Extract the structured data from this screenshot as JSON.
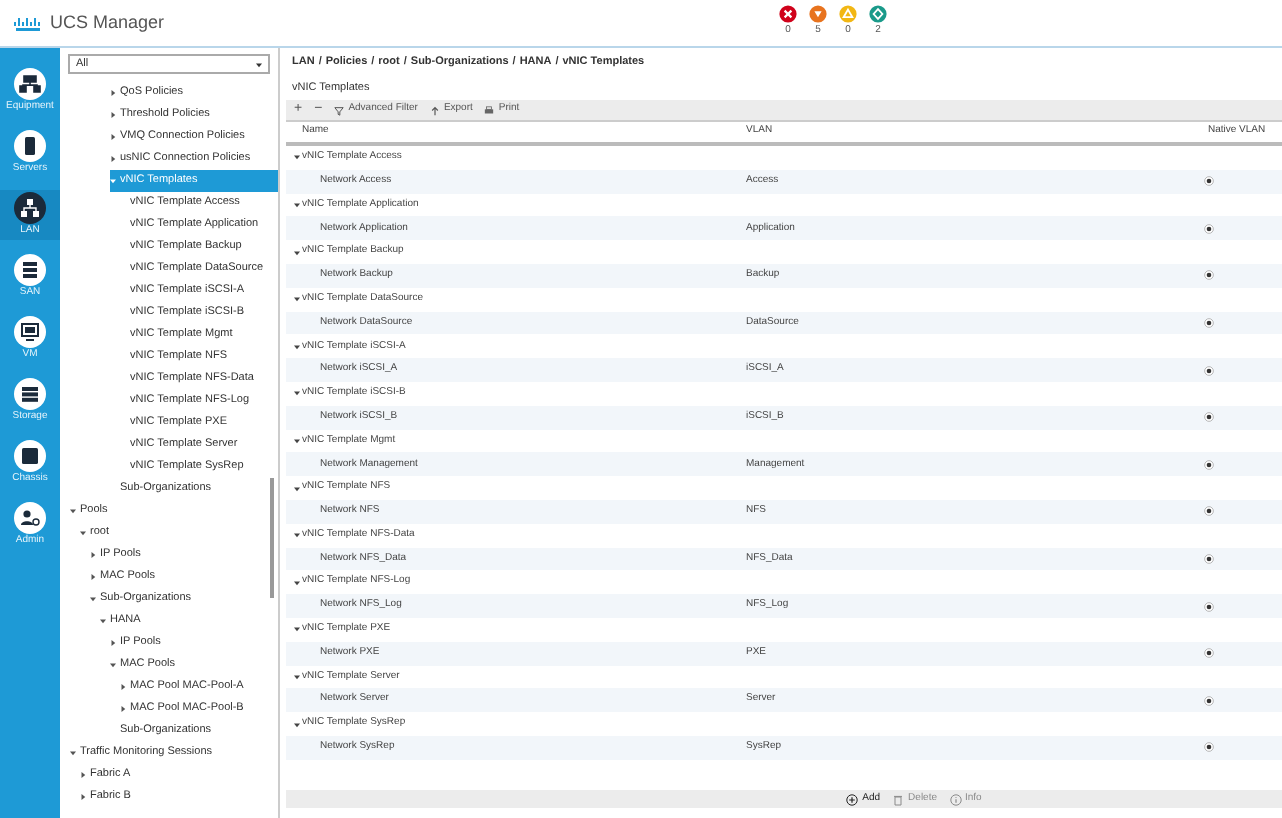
{
  "window": {
    "title": "UCS Manager"
  },
  "faults": [
    {
      "kind": "critical",
      "count": "0"
    },
    {
      "kind": "major",
      "count": "5"
    },
    {
      "kind": "minor",
      "count": "0"
    },
    {
      "kind": "warning",
      "count": "2"
    }
  ],
  "nav_rail": [
    {
      "kind": "equipment",
      "label": "Equipment",
      "selected": false
    },
    {
      "kind": "servers",
      "label": "Servers",
      "selected": false
    },
    {
      "kind": "lan",
      "label": "LAN",
      "selected": true
    },
    {
      "kind": "san",
      "label": "SAN",
      "selected": false
    },
    {
      "kind": "vm",
      "label": "VM",
      "selected": false
    },
    {
      "kind": "storage",
      "label": "Storage",
      "selected": false
    },
    {
      "kind": "chassis",
      "label": "Chassis",
      "selected": false
    },
    {
      "kind": "admin",
      "label": "Admin",
      "selected": false
    }
  ],
  "filter": {
    "value": "All"
  },
  "tree_groups": [
    [
      {
        "label": "QoS Policies",
        "expanded": false,
        "selected": false
      },
      {
        "label": "Threshold Policies",
        "expanded": false,
        "selected": false
      },
      {
        "label": "VMQ Connection Policies",
        "expanded": false,
        "selected": false
      },
      {
        "label": "usNIC Connection Policies",
        "expanded": false,
        "selected": false
      },
      {
        "label": "vNIC Templates",
        "expanded": true,
        "selected": true,
        "children": [
          {
            "label": "vNIC Template Access",
            "selected": false
          },
          {
            "label": "vNIC Template Application",
            "selected": false
          },
          {
            "label": "vNIC Template Backup",
            "selected": false
          },
          {
            "label": "vNIC Template DataSource",
            "selected": false
          },
          {
            "label": "vNIC Template iSCSI-A",
            "selected": false
          },
          {
            "label": "vNIC Template iSCSI-B",
            "selected": false
          },
          {
            "label": "vNIC Template Mgmt",
            "selected": false
          },
          {
            "label": "vNIC Template NFS",
            "selected": false
          },
          {
            "label": "vNIC Template NFS-Data",
            "selected": false
          },
          {
            "label": "vNIC Template NFS-Log",
            "selected": false
          },
          {
            "label": "vNIC Template PXE",
            "selected": false
          },
          {
            "label": "vNIC Template Server",
            "selected": false
          },
          {
            "label": "vNIC Template SysRep",
            "selected": false
          }
        ]
      },
      {
        "label": "Sub-Organizations",
        "selected": false
      }
    ],
    [
      {
        "label": "Pools",
        "expanded": true,
        "selected": false,
        "children": [
          {
            "label": "root",
            "expanded": true,
            "selected": false,
            "children": [
              {
                "label": "IP Pools",
                "expanded": false,
                "selected": false
              },
              {
                "label": "MAC Pools",
                "expanded": false,
                "selected": false
              },
              {
                "label": "Sub-Organizations",
                "expanded": true,
                "selected": false,
                "children": [
                  {
                    "label": "HANA",
                    "expanded": true,
                    "selected": false,
                    "children": [
                      {
                        "label": "IP Pools",
                        "expanded": false,
                        "selected": false
                      },
                      {
                        "label": "MAC Pools",
                        "expanded": true,
                        "selected": false,
                        "children": [
                          {
                            "label": "MAC Pool MAC-Pool-A",
                            "expanded": false,
                            "selected": false
                          },
                          {
                            "label": "MAC Pool MAC-Pool-B",
                            "expanded": false,
                            "selected": false
                          }
                        ]
                      },
                      {
                        "label": "Sub-Organizations",
                        "selected": false
                      }
                    ]
                  }
                ]
              }
            ]
          }
        ]
      },
      {
        "label": "Traffic Monitoring Sessions",
        "expanded": true,
        "selected": false,
        "children": [
          {
            "label": "Fabric A",
            "expanded": false,
            "selected": false
          },
          {
            "label": "Fabric B",
            "expanded": false,
            "selected": false
          }
        ]
      }
    ]
  ],
  "breadcrumb": [
    "LAN",
    "Policies",
    "root",
    "Sub-Organizations",
    "HANA",
    "vNIC Templates"
  ],
  "breadcrumb_separator": "/",
  "panel_title": "vNIC Templates",
  "toolbar": [
    {
      "kind": "add",
      "label": "+"
    },
    {
      "kind": "remove",
      "label": "−"
    },
    {
      "kind": "filter",
      "label": "Advanced Filter"
    },
    {
      "kind": "export",
      "label": "Export"
    },
    {
      "kind": "print",
      "label": "Print"
    }
  ],
  "table": {
    "columns": [
      "Name",
      "VLAN",
      "Native VLAN"
    ],
    "rows": [
      {
        "template": "vNIC Template Access",
        "expanded": true,
        "network": "Network Access",
        "vlan": "Access",
        "native": true
      },
      {
        "template": "vNIC Template Application",
        "expanded": true,
        "network": "Network Application",
        "vlan": "Application",
        "native": true
      },
      {
        "template": "vNIC Template Backup",
        "expanded": true,
        "network": "Network Backup",
        "vlan": "Backup",
        "native": true
      },
      {
        "template": "vNIC Template DataSource",
        "expanded": true,
        "network": "Network DataSource",
        "vlan": "DataSource",
        "native": true
      },
      {
        "template": "vNIC Template iSCSI-A",
        "expanded": true,
        "network": "Network iSCSI_A",
        "vlan": "iSCSI_A",
        "native": true
      },
      {
        "template": "vNIC Template iSCSI-B",
        "expanded": true,
        "network": "Network iSCSI_B",
        "vlan": "iSCSI_B",
        "native": true
      },
      {
        "template": "vNIC Template Mgmt",
        "expanded": true,
        "network": "Network Management",
        "vlan": "Management",
        "native": true
      },
      {
        "template": "vNIC Template NFS",
        "expanded": true,
        "network": "Network NFS",
        "vlan": "NFS",
        "native": true
      },
      {
        "template": "vNIC Template NFS-Data",
        "expanded": true,
        "network": "Network NFS_Data",
        "vlan": "NFS_Data",
        "native": true
      },
      {
        "template": "vNIC Template NFS-Log",
        "expanded": true,
        "network": "Network NFS_Log",
        "vlan": "NFS_Log",
        "native": true
      },
      {
        "template": "vNIC Template PXE",
        "expanded": true,
        "network": "Network PXE",
        "vlan": "PXE",
        "native": true
      },
      {
        "template": "vNIC Template Server",
        "expanded": true,
        "network": "Network Server",
        "vlan": "Server",
        "native": true
      },
      {
        "template": "vNIC Template SysRep",
        "expanded": true,
        "network": "Network SysRep",
        "vlan": "SysRep",
        "native": true
      }
    ]
  },
  "footer_actions": [
    {
      "kind": "add",
      "label": "Add",
      "disabled": false
    },
    {
      "kind": "delete",
      "label": "Delete",
      "disabled": true
    },
    {
      "kind": "info",
      "label": "Info",
      "disabled": true
    }
  ]
}
